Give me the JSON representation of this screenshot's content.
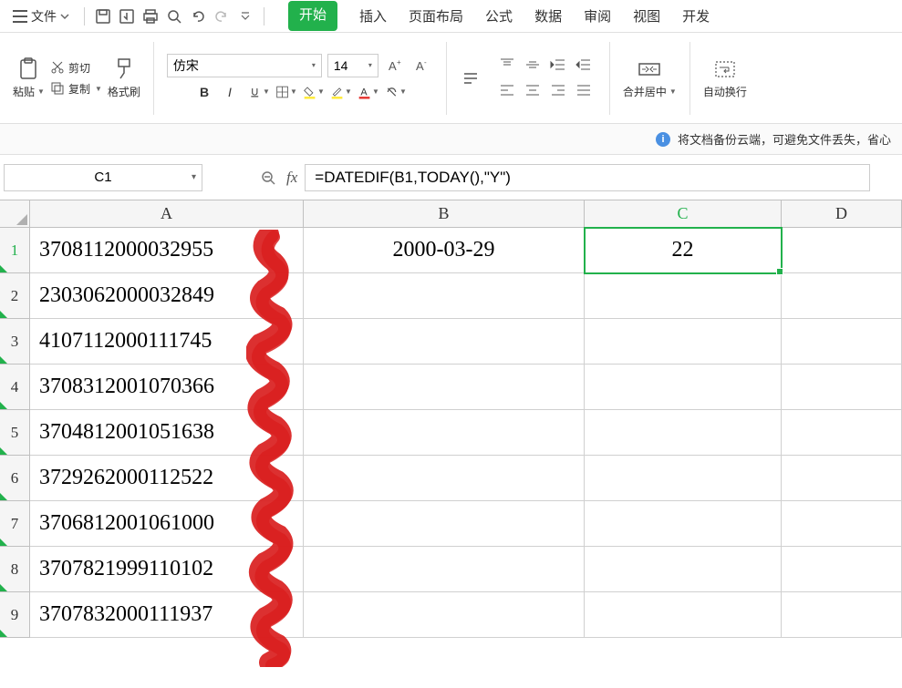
{
  "menu": {
    "file": "文件",
    "tabs": [
      "开始",
      "插入",
      "页面布局",
      "公式",
      "数据",
      "审阅",
      "视图",
      "开发"
    ],
    "active_tab": 0
  },
  "toolbar": {
    "paste": "粘贴",
    "cut": "剪切",
    "copy": "复制",
    "format_painter": "格式刷",
    "font_name": "仿宋",
    "font_size": "14",
    "merge_center": "合并居中",
    "auto_wrap": "自动换行"
  },
  "info_banner": "将文档备份云端，可避免文件丢失，省心",
  "name_box": "C1",
  "formula": "=DATEDIF(B1,TODAY(),\"Y\")",
  "columns": [
    "A",
    "B",
    "C",
    "D"
  ],
  "active_col": "C",
  "active_row": 1,
  "rows": [
    {
      "n": 1,
      "A": "3708112000032955",
      "B": "2000-03-29",
      "C": "22"
    },
    {
      "n": 2,
      "A": "2303062000032849"
    },
    {
      "n": 3,
      "A": "4107112000111745"
    },
    {
      "n": 4,
      "A": "3708312001070366"
    },
    {
      "n": 5,
      "A": "3704812001051638"
    },
    {
      "n": 6,
      "A": "3729262000112522"
    },
    {
      "n": 7,
      "A": "3706812001061000"
    },
    {
      "n": 8,
      "A": "3707821999110102"
    },
    {
      "n": 9,
      "A": "3707832000111937"
    }
  ]
}
